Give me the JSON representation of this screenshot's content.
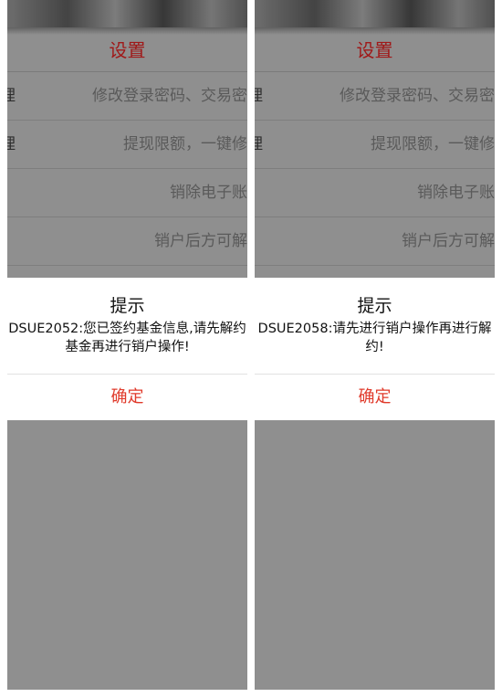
{
  "screens": [
    {
      "header": {
        "title": "设置"
      },
      "rows": [
        {
          "label": "理",
          "value": "修改登录密码、交易密"
        },
        {
          "label": "理",
          "value": "提现限额，一键修"
        },
        {
          "label": "",
          "value": "销除电子账"
        },
        {
          "label": "",
          "value": "销户后方可解"
        }
      ],
      "dialog": {
        "title": "提示",
        "message_line1": "DSUE2052:您已签约基金信息,请先解约",
        "message_line2": "基金再进行销户操作!",
        "confirm_label": "确定"
      }
    },
    {
      "header": {
        "title": "设置"
      },
      "rows": [
        {
          "label": "理",
          "value": "修改登录密码、交易密"
        },
        {
          "label": "理",
          "value": "提现限额，一键修"
        },
        {
          "label": "",
          "value": "销除电子账"
        },
        {
          "label": "",
          "value": "销户后方可解"
        }
      ],
      "dialog": {
        "title": "提示",
        "message_line1": "DSUE2058:请先进行销户操作再进行解",
        "message_line2": "约!",
        "confirm_label": "确定"
      }
    }
  ],
  "colors": {
    "header_red": "#a01818",
    "confirm_red": "#e03a2b",
    "overlay_gray": "#8f8f8f"
  }
}
